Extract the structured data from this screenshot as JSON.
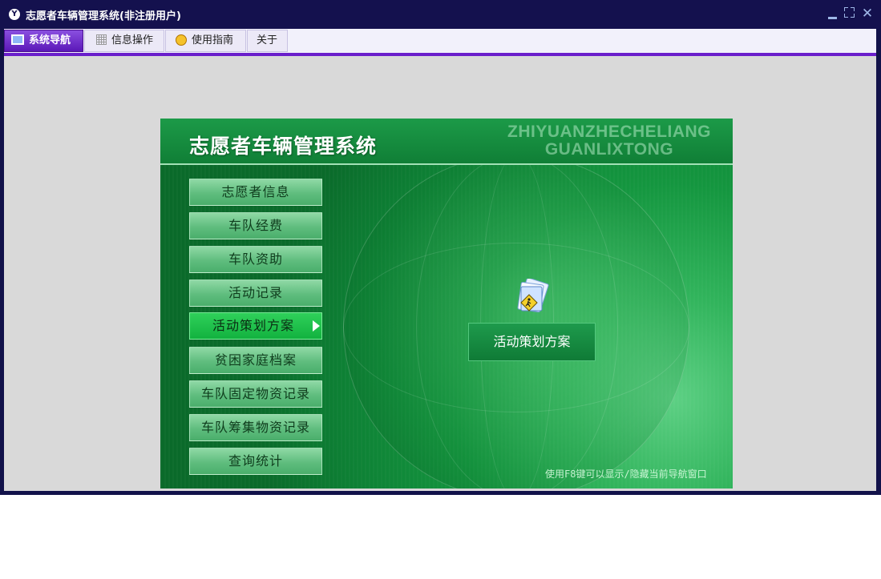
{
  "window": {
    "title": "志愿者车辆管理系统(非注册用户)",
    "app_icon_glyph": "Y",
    "controls": [
      "minimize-icon",
      "restore-icon",
      "close-icon"
    ]
  },
  "menu": {
    "tabs": [
      {
        "label": "系统导航",
        "icon": "monitor-icon",
        "active": true
      },
      {
        "label": "信息操作",
        "icon": "grid-icon",
        "active": false
      },
      {
        "label": "使用指南",
        "icon": "guide-icon",
        "active": false
      },
      {
        "label": "关于",
        "icon": "",
        "active": false
      }
    ],
    "accent_color": "#6a1ecb"
  },
  "panel": {
    "title": "志愿者车辆管理系统",
    "pinyin_line1": "ZHIYUANZHECHELIANG",
    "pinyin_line2": "GUANLIXTONG",
    "nav_items": [
      {
        "label": "志愿者信息"
      },
      {
        "label": "车队经费"
      },
      {
        "label": "车队资助"
      },
      {
        "label": "活动记录"
      },
      {
        "label": "活动策划方案",
        "active": true
      },
      {
        "label": "贫困家庭档案"
      },
      {
        "label": "车队固定物资记录"
      },
      {
        "label": "车队筹集物资记录"
      },
      {
        "label": "查询统计"
      }
    ],
    "feature": {
      "label": "活动策划方案",
      "icon": "document-folder-icon"
    },
    "hint": "使用F8键可以显示/隐藏当前导航窗口",
    "theme_color": "#14963f"
  }
}
